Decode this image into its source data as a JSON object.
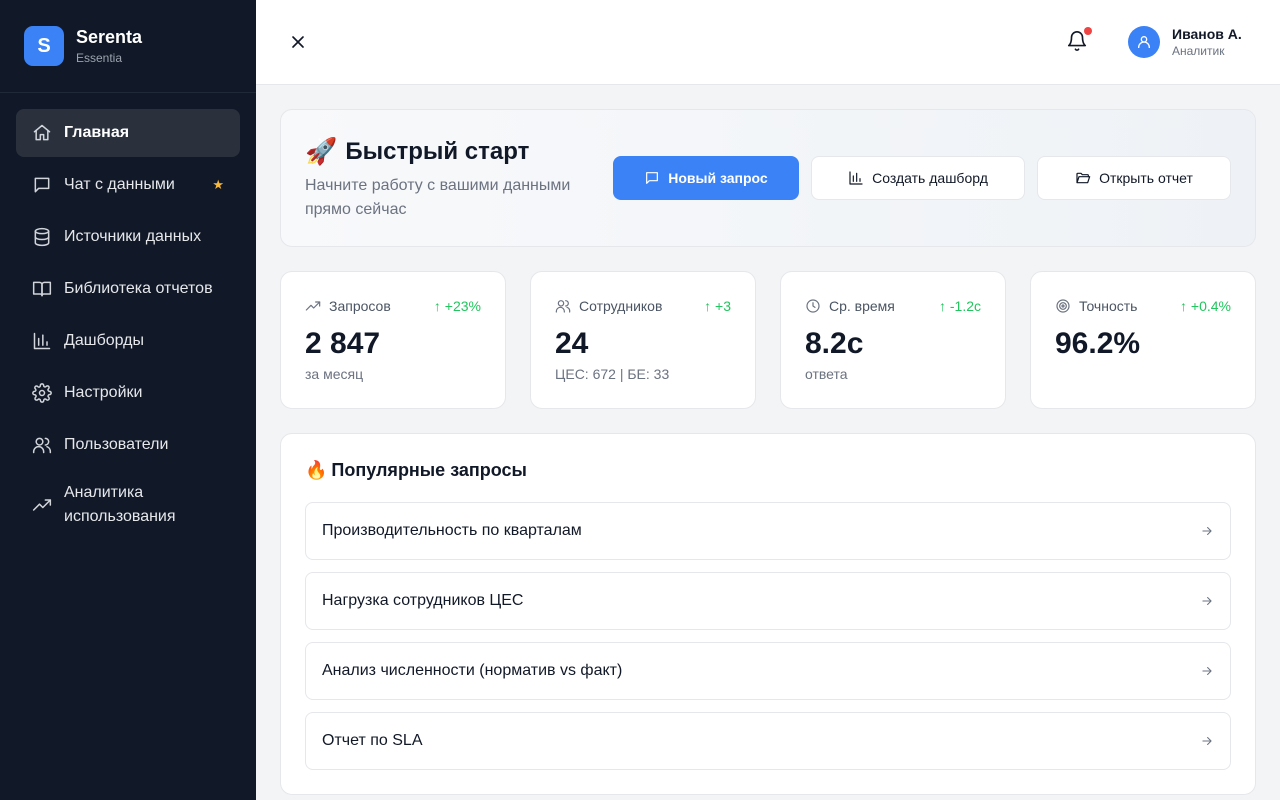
{
  "brand": {
    "logo_letter": "S",
    "name": "Serenta",
    "subtitle": "Essentia"
  },
  "sidebar": {
    "items": [
      {
        "label": "Главная",
        "icon": "home-icon",
        "active": true
      },
      {
        "label": "Чат с данными",
        "icon": "chat-icon",
        "badge": "★"
      },
      {
        "label": "Источники данных",
        "icon": "database-icon"
      },
      {
        "label": "Библиотека отчетов",
        "icon": "book-icon"
      },
      {
        "label": "Дашборды",
        "icon": "bar-chart-icon"
      },
      {
        "label": "Настройки",
        "icon": "gear-icon"
      },
      {
        "label": "Пользователи",
        "icon": "users-icon"
      },
      {
        "label": "Аналитика использования",
        "icon": "trending-icon"
      }
    ]
  },
  "header": {
    "user_name": "Иванов А.",
    "user_role": "Аналитик",
    "notification_dot_color": "#ef4444"
  },
  "quick_start": {
    "emoji": "🚀",
    "title": "Быстрый старт",
    "subtitle": "Начните работу с вашими данными прямо сейчас",
    "buttons": {
      "new_request": "Новый запрос",
      "create_dashboard": "Создать дашборд",
      "open_report": "Открыть отчет"
    }
  },
  "stats": [
    {
      "label": "Запросов",
      "icon": "trending-icon",
      "delta": "↑ +23%",
      "value": "2 847",
      "note": "за месяц"
    },
    {
      "label": "Сотрудников",
      "icon": "users-icon",
      "delta": "↑ +3",
      "value": "24",
      "note": "ЦЕС: 672 | БЕ: 33"
    },
    {
      "label": "Ср. время",
      "icon": "clock-icon",
      "delta": "↑ -1.2с",
      "value": "8.2с",
      "note": "ответа"
    },
    {
      "label": "Точность",
      "icon": "target-icon",
      "delta": "↑ +0.4%",
      "value": "96.2%",
      "note": ""
    }
  ],
  "popular": {
    "emoji": "🔥",
    "title": "Популярные запросы",
    "items": [
      "Производительность по кварталам",
      "Нагрузка сотрудников ЦЕС",
      "Анализ численности (норматив vs факт)",
      "Отчет по SLA"
    ]
  },
  "colors": {
    "accent": "#3b82f6",
    "sidebar": "#111827",
    "positive": "#22c55e",
    "star": "#f5b840"
  }
}
